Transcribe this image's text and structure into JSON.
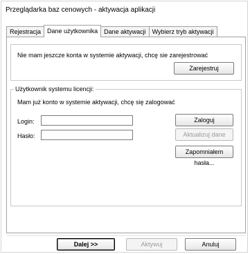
{
  "window": {
    "title": "Przeglądarka baz cenowych - aktywacja aplikacji"
  },
  "tabs": [
    {
      "label": "Rejestracja"
    },
    {
      "label": "Dane użytkownika"
    },
    {
      "label": "Dane aktywacji"
    },
    {
      "label": "Wybierz tryb aktywacji"
    }
  ],
  "register_box": {
    "message": "Nie mam jeszcze konta w systemie aktywacji, chcę sie zarejestrować",
    "register_button": "Zarejestruj"
  },
  "login_group": {
    "title": "Użytkownik systemu licencji:",
    "message": "Mam już konto w systemie aktywacji, chcę się zalogować",
    "login_label": "Login:",
    "login_value": "",
    "password_label": "Hasło:",
    "password_value": "",
    "login_button": "Zaloguj",
    "update_button": "Aktualizuj dane",
    "forgot_button": "Zapomniałem hasła..."
  },
  "footer": {
    "next_button": "Dalej >>",
    "activate_button": "Aktywuj",
    "cancel_button": "Anuluj"
  }
}
